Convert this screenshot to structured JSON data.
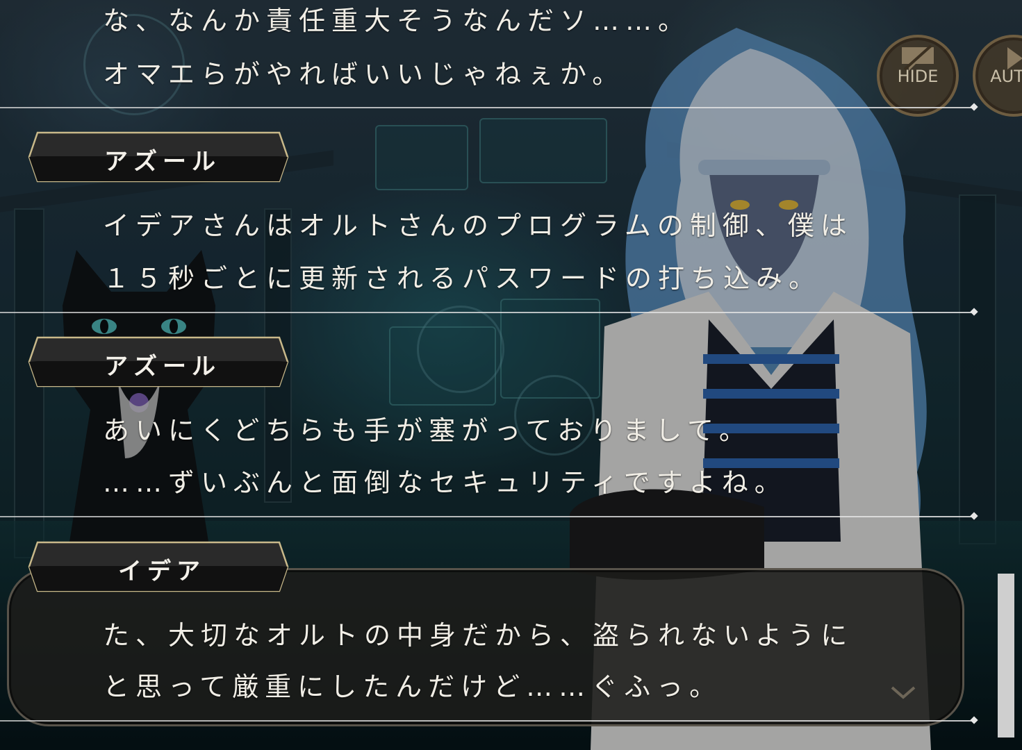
{
  "log": [
    {
      "speaker": "",
      "lines": [
        "な、なんか責任重大そうなんだソ……。",
        "オマエらがやればいいじゃねぇか。"
      ]
    },
    {
      "speaker": "アズール",
      "lines": [
        "イデアさんはオルトさんのプログラムの制御、僕は",
        "１５秒ごとに更新されるパスワードの打ち込み。"
      ]
    },
    {
      "speaker": "アズール",
      "lines": [
        "あいにくどちらも手が塞がっておりまして。",
        "……ずいぶんと面倒なセキュリティですよね。"
      ]
    },
    {
      "speaker": "イデア",
      "lines": [
        "た、大切なオルトの中身だから、盗られないように",
        "と思って厳重にしたんだけど……ぐふっ。"
      ]
    }
  ],
  "controls": {
    "hide_label": "HIDE",
    "auto_label": "AUTO"
  },
  "scroll": {
    "position": 1.0
  },
  "colors": {
    "text": "#f1eee6",
    "dialog_bg": "#1c1c1a",
    "nameplate_border": "#c9b98a"
  }
}
